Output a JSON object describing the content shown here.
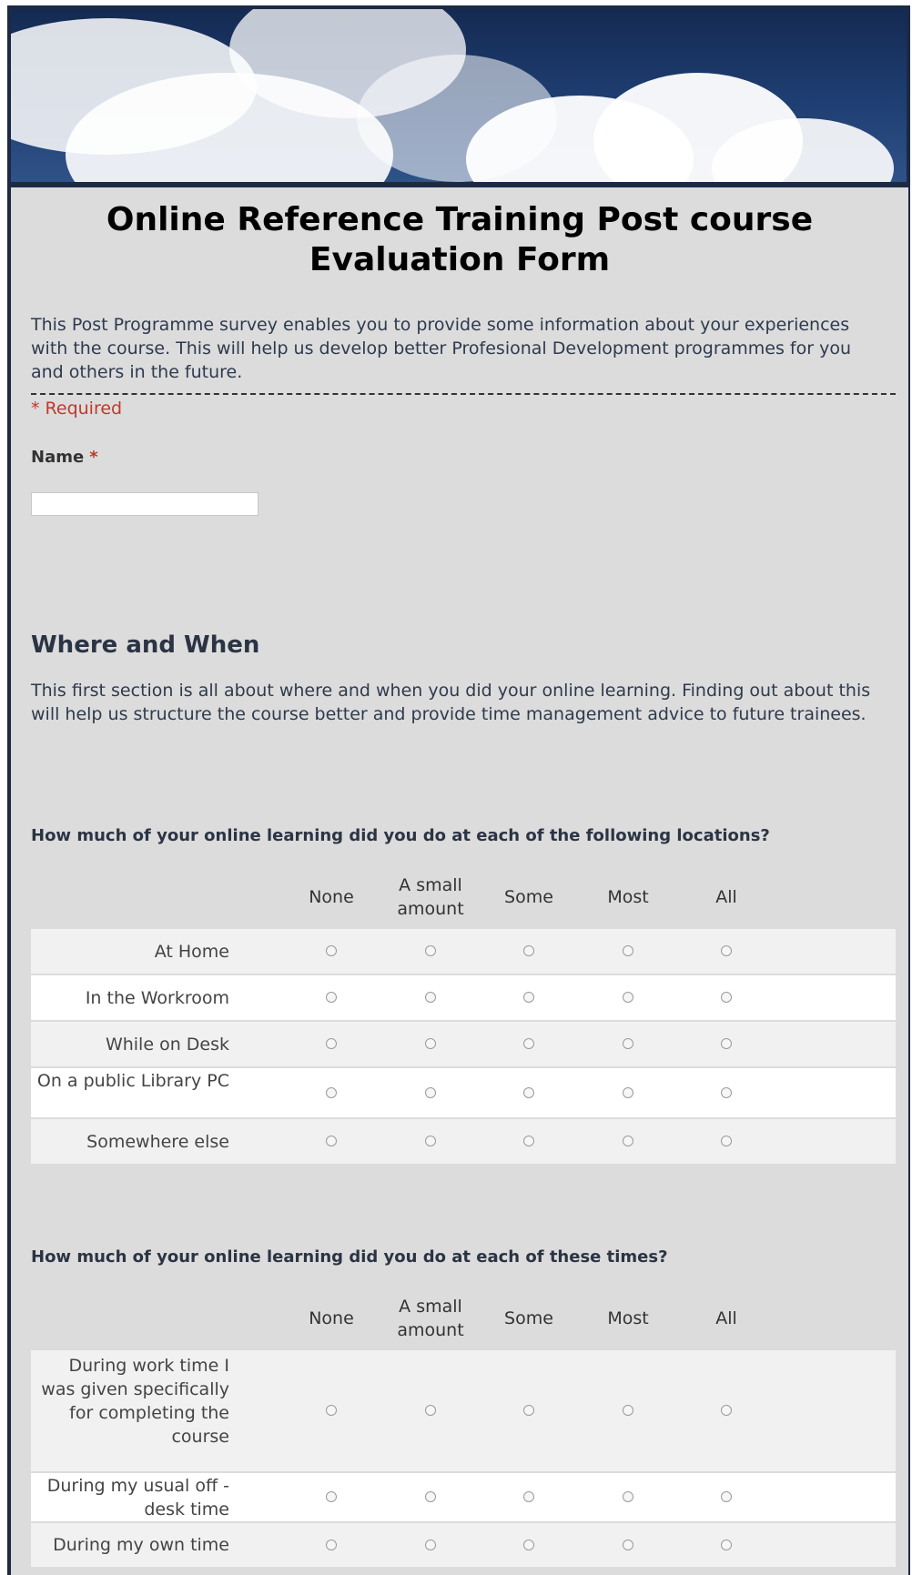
{
  "form": {
    "title_line1": "Online Reference Training Post course",
    "title_line2": "Evaluation Form",
    "description": "This Post Programme survey enables you to provide some information about your experiences with the course. This will help us develop better Profesional Development programmes for you and others in the future.",
    "required_note": "* Required"
  },
  "name_field": {
    "label": "Name",
    "required_mark": "*",
    "value": ""
  },
  "section": {
    "title": "Where and When",
    "description": "This first section is all about where and when you did your online learning. Finding out about this will help us structure the course better and provide time management advice to future trainees."
  },
  "columns": [
    "None",
    "A small amount",
    "Some",
    "Most",
    "All"
  ],
  "questions": [
    {
      "text": "How much of your online learning did you do at each of the following locations?",
      "rows": [
        "At Home",
        "In the Workroom",
        "While on Desk",
        "On a public Library PC",
        "Somewhere else"
      ]
    },
    {
      "text": "How much of your online learning did you do at each of these times?",
      "rows": [
        "During work time I was given specifically for completing the course",
        "During my usual off -desk time",
        "During my own time"
      ]
    }
  ]
}
